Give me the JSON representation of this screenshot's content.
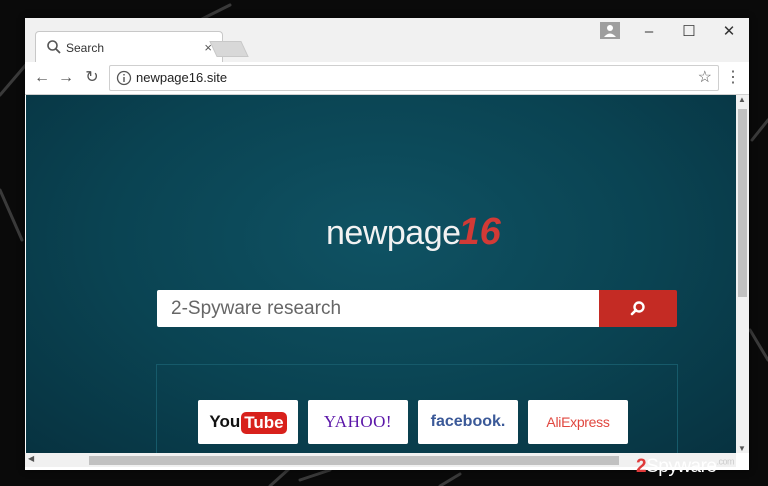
{
  "browser": {
    "tab": {
      "title": "Search",
      "close": "×"
    },
    "window_controls": {
      "minimize": "–",
      "maximize": "☐",
      "close": "✕"
    },
    "toolbar": {
      "back": "←",
      "forward": "→",
      "reload": "↻",
      "url": "newpage16.site",
      "star": "☆",
      "menu": "⋮"
    }
  },
  "page": {
    "logo": {
      "text": "newpage",
      "number": "16"
    },
    "search": {
      "value": "2-Spyware research"
    },
    "quick_links": [
      {
        "name": "YouTube",
        "part1": "You",
        "part2": "Tube"
      },
      {
        "name": "YAHOO!",
        "label": "YAHOO!"
      },
      {
        "name": "facebook",
        "label": "facebook."
      },
      {
        "name": "AliExpress",
        "label": "AliExpress"
      }
    ]
  },
  "watermark": {
    "num": "2",
    "text": "Spyware",
    "tld": ".com"
  },
  "colors": {
    "page_bg": "#0a4352",
    "search_button": "#c42b24",
    "logo_accent": "#d23a36"
  },
  "icons": [
    "search-icon",
    "close-icon",
    "back-arrow-icon",
    "forward-arrow-icon",
    "reload-icon",
    "info-icon",
    "star-icon",
    "menu-icon",
    "magnifier-icon",
    "profile-icon"
  ]
}
